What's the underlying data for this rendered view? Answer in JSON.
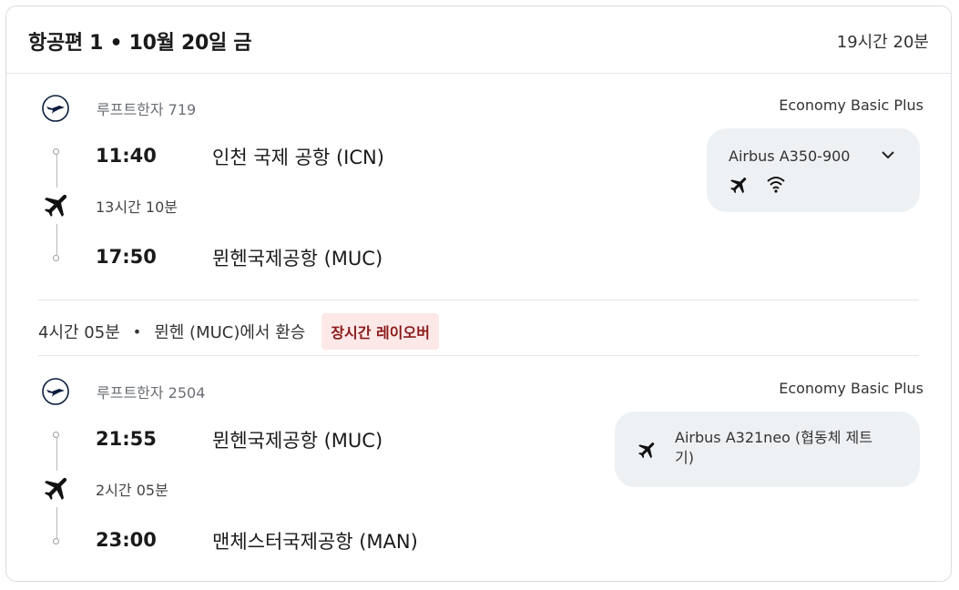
{
  "header": {
    "title": "항공편 1 • 10월 20일 금",
    "total_duration": "19시간 20분"
  },
  "legs": [
    {
      "airline": "루프트한자 719",
      "cabin": "Economy Basic Plus",
      "departure_time": "11:40",
      "departure_airport": "인천 국제 공항 (ICN)",
      "duration": "13시간 10분",
      "arrival_time": "17:50",
      "arrival_airport": "뮌헨국제공항 (MUC)",
      "aircraft": "Airbus A350-900",
      "amenities": [
        "plane-icon",
        "wifi-icon"
      ]
    },
    {
      "airline": "루프트한자 2504",
      "cabin": "Economy Basic Plus",
      "departure_time": "21:55",
      "departure_airport": "뮌헨국제공항 (MUC)",
      "duration": "2시간 05분",
      "arrival_time": "23:00",
      "arrival_airport": "맨체스터국제공항 (MAN)",
      "aircraft_line1": "Airbus A321neo (협동체 제트",
      "aircraft_line2": "기)"
    }
  ],
  "layover": {
    "duration": "4시간 05분",
    "separator": "•",
    "location": "뮌헨 (MUC)에서 환승",
    "badge": "장시간 레이오버"
  },
  "colors": {
    "badge_bg": "#fde8e8",
    "badge_text": "#8b1a1a",
    "aircraft_box_bg": "#eef1f4"
  }
}
